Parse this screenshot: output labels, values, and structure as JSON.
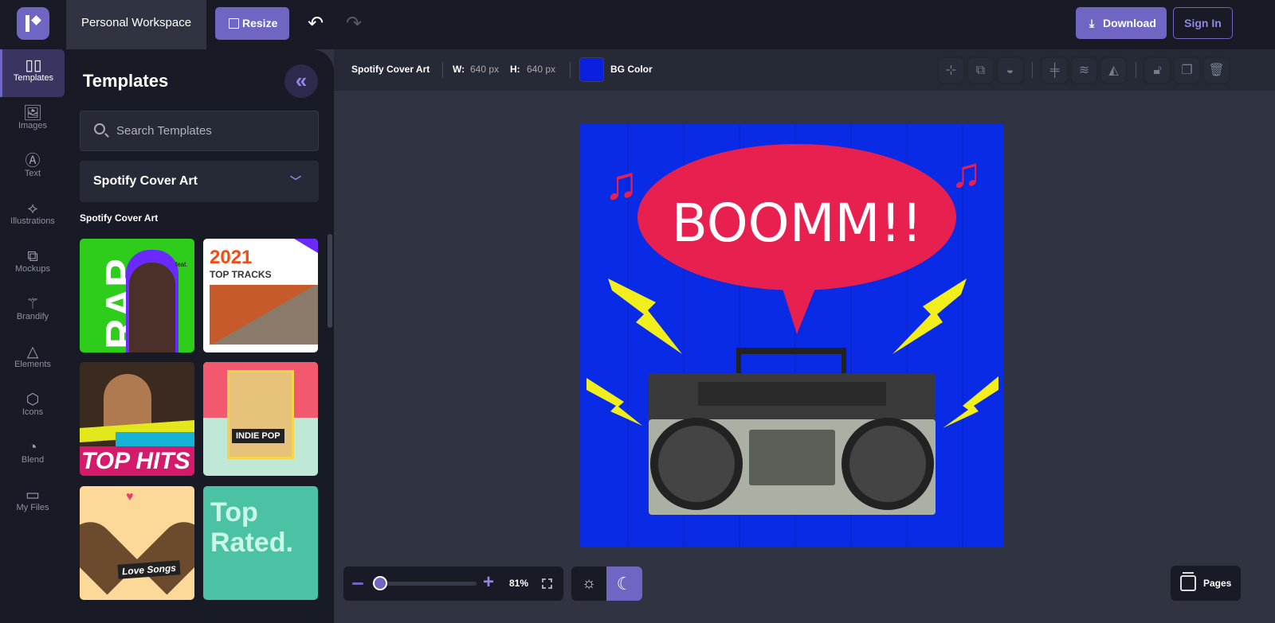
{
  "header": {
    "workspace": "Personal Workspace",
    "resize_label": "Resize",
    "download_label": "Download",
    "signin_label": "Sign In"
  },
  "rail": {
    "items": [
      {
        "label": "Templates",
        "icon": "templates-icon",
        "glyph": "▯▯"
      },
      {
        "label": "Images",
        "icon": "image-icon",
        "glyph": "🖼"
      },
      {
        "label": "Text",
        "icon": "text-icon",
        "glyph": "Ⓐ"
      },
      {
        "label": "Illustrations",
        "icon": "illustrations-icon",
        "glyph": "⟡"
      },
      {
        "label": "Mockups",
        "icon": "mockups-icon",
        "glyph": "⧉"
      },
      {
        "label": "Brandify",
        "icon": "magic-wand-icon",
        "glyph": "⚚"
      },
      {
        "label": "Elements",
        "icon": "shapes-icon",
        "glyph": "△"
      },
      {
        "label": "Icons",
        "icon": "cube-icon",
        "glyph": "⬡"
      },
      {
        "label": "Blend",
        "icon": "palette-icon",
        "glyph": "◔"
      },
      {
        "label": "My Files",
        "icon": "folder-icon",
        "glyph": "▭"
      }
    ]
  },
  "panel": {
    "title": "Templates",
    "search_placeholder": "Search Templates",
    "category": "Spotify Cover Art",
    "section_label": "Spotify Cover Art",
    "templates": [
      {
        "text": "RAP",
        "sub": "feat."
      },
      {
        "text": "2021",
        "sub": "TOP TRACKS"
      },
      {
        "text": "TOP HITS"
      },
      {
        "text": "INDIE POP"
      },
      {
        "text": "Love Songs"
      },
      {
        "text": "Top Rated."
      }
    ]
  },
  "toolbar": {
    "doc_name": "Spotify Cover Art",
    "w_label": "W:",
    "w_value": "640 px",
    "h_label": "H:",
    "h_value": "640 px",
    "bg_label": "BG Color",
    "bg_color": "#0a1fe0"
  },
  "canvas": {
    "headline": "BOOMM!!"
  },
  "zoom": {
    "percent": "81%",
    "level": 0.81
  },
  "pages_label": "Pages",
  "colors": {
    "accent": "#6f66c4",
    "dark": "#181b25",
    "canvas_bg": "#0a1fe0",
    "bubble": "#e8204f",
    "bolt": "#f2ee1c"
  }
}
